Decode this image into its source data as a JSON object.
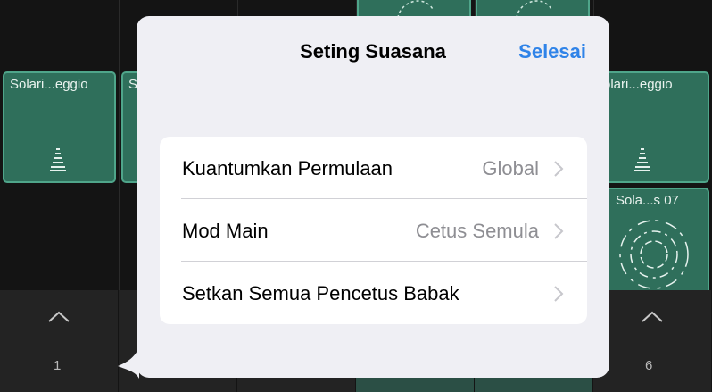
{
  "background": {
    "cells": [
      {
        "label": "Solari...eggio",
        "icon": "waveform-stack-icon"
      },
      {
        "label": "S",
        "icon": "none"
      },
      {
        "label": "olari...eggio",
        "icon": "waveform-stack-icon"
      },
      {
        "label": "Sola...s 07",
        "icon": "circular-waveform-icon"
      }
    ],
    "columns": [
      {
        "number": "1"
      },
      {
        "number": "6"
      }
    ]
  },
  "popover": {
    "title": "Seting Suasana",
    "done_label": "Selesai",
    "rows": [
      {
        "label": "Kuantumkan Permulaan",
        "value": "Global"
      },
      {
        "label": "Mod Main",
        "value": "Cetus Semula"
      },
      {
        "label": "Setkan Semua Pencetus Babak",
        "value": ""
      }
    ]
  },
  "colors": {
    "accent": "#2f83e8",
    "cell_fill": "#2f6f5b",
    "cell_border": "#4fa58a"
  }
}
